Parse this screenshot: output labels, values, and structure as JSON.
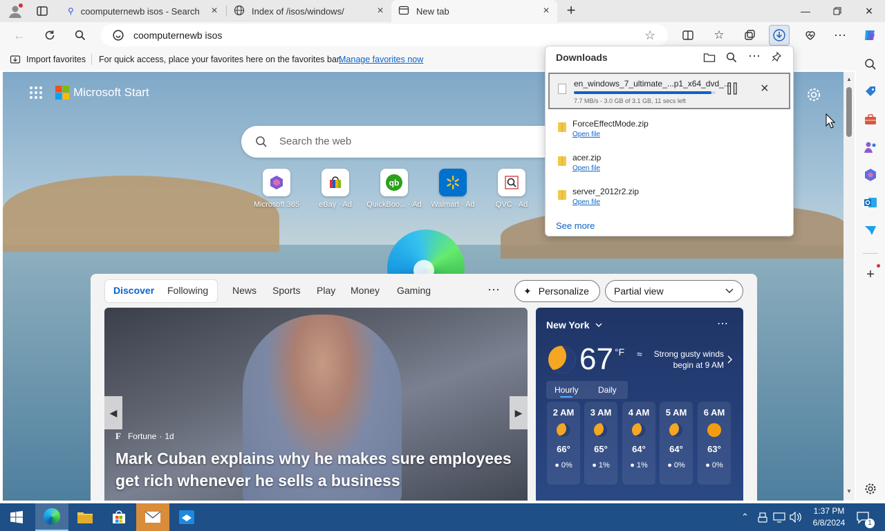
{
  "tabs": [
    {
      "title": "coomputernewb isos - Search",
      "icon": "search-icon"
    },
    {
      "title": "Index of /isos/windows/",
      "icon": "globe-icon"
    },
    {
      "title": "New tab",
      "icon": "newtab-icon"
    }
  ],
  "address": {
    "url": "coomputernewb isos"
  },
  "favorites_bar": {
    "import_label": "Import favorites",
    "hint": "For quick access, place your favorites here on the favorites bar.",
    "manage_link": "Manage favorites now"
  },
  "start": {
    "brand": "Microsoft Start",
    "search_placeholder": "Search the web"
  },
  "quick_links": [
    {
      "label": "Microsoft 365",
      "icon": "microsoft365-icon"
    },
    {
      "label": "eBay · Ad",
      "icon": "ebay-icon"
    },
    {
      "label": "QuickBoo... · Ad",
      "icon": "quickbooks-icon"
    },
    {
      "label": "Walmart · Ad",
      "icon": "walmart-icon"
    },
    {
      "label": "QVC · Ad",
      "icon": "qvc-icon"
    }
  ],
  "feed": {
    "tabs": [
      "Discover",
      "Following",
      "News",
      "Sports",
      "Play",
      "Money",
      "Gaming"
    ],
    "personalize": "Personalize",
    "view": "Partial view",
    "story": {
      "source": "Fortune",
      "age": "1d",
      "headline": "Mark Cuban explains why he makes sure employees get rich whenever he sells a business"
    }
  },
  "weather": {
    "location": "New York",
    "temp": "67",
    "unit": "°F",
    "alert": "Strong gusty winds begin at 9 AM",
    "tabs": [
      "Hourly",
      "Daily"
    ],
    "hours": [
      {
        "time": "2 AM",
        "temp": "66°",
        "rain": "0%"
      },
      {
        "time": "3 AM",
        "temp": "65°",
        "rain": "1%"
      },
      {
        "time": "4 AM",
        "temp": "64°",
        "rain": "1%"
      },
      {
        "time": "5 AM",
        "temp": "64°",
        "rain": "0%"
      },
      {
        "time": "6 AM",
        "temp": "63°",
        "rain": "0%"
      }
    ]
  },
  "downloads": {
    "title": "Downloads",
    "active": {
      "name": "en_windows_7_ultimate_...p1_x64_dvd_...",
      "status": "7.7 MB/s - 3.0 GB of 3.1 GB, 11 secs left",
      "progress": 0.97
    },
    "items": [
      {
        "name": "ForceEffectMode.zip",
        "action": "Open file"
      },
      {
        "name": "acer.zip",
        "action": "Open file"
      },
      {
        "name": "server_2012r2.zip",
        "action": "Open file"
      }
    ],
    "see_more": "See more"
  },
  "taskbar": {
    "time": "1:37 PM",
    "date": "6/8/2024",
    "notifications": "1"
  },
  "colors": {
    "accent": "#0a64c8",
    "taskbar": "#1e4f86",
    "weather_bg": "#26407a"
  }
}
